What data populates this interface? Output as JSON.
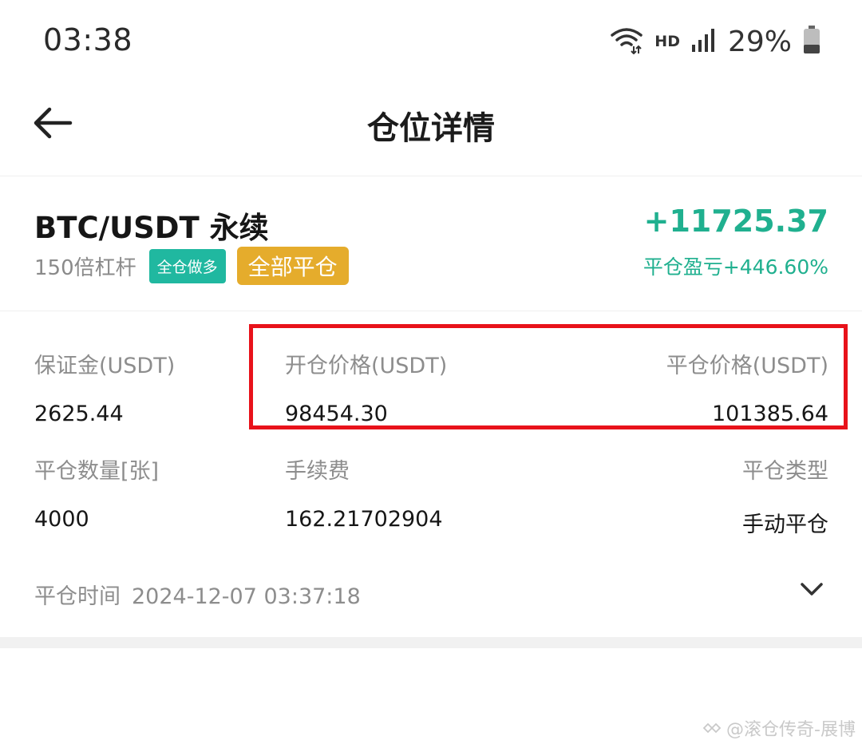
{
  "status_bar": {
    "time": "03:38",
    "network": "HD",
    "battery": "29%",
    "icons": [
      "wifi-icon",
      "signal-icon",
      "battery-icon"
    ]
  },
  "header": {
    "title": "仓位详情",
    "back_icon": "arrow-left-icon"
  },
  "position": {
    "symbol": "BTC/USDT 永续",
    "leverage": "150倍杠杆",
    "mode_tag": "全仓做多",
    "close_tag": "全部平仓",
    "pnl": "+11725.37",
    "pnl_ratio": "平仓盈亏+446.60%"
  },
  "details": {
    "margin_label": "保证金(USDT)",
    "margin_value": "2625.44",
    "open_price_label": "开仓价格(USDT)",
    "open_price_value": "98454.30",
    "close_price_label": "平仓价格(USDT)",
    "close_price_value": "101385.64",
    "close_qty_label": "平仓数量[张]",
    "close_qty_value": "4000",
    "fee_label": "手续费",
    "fee_value": "162.21702904",
    "close_type_label": "平仓类型",
    "close_type_value": "手动平仓",
    "close_time_label": "平仓时间",
    "close_time_value": "2024-12-07 03:37:18"
  },
  "watermark": "@滚仓传奇-展博",
  "colors": {
    "profit": "#20b08f",
    "tag_cross": "#20b8a0",
    "tag_close": "#e5ac2c",
    "highlight": "#e8121a"
  }
}
